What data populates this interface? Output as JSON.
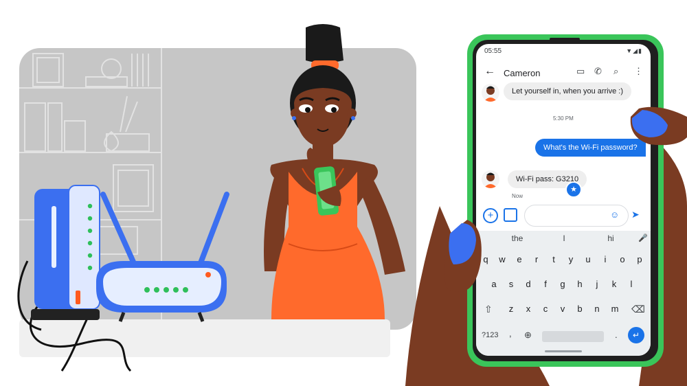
{
  "status_bar": {
    "time": "05:55",
    "icons": "▼◢▮"
  },
  "app_bar": {
    "back_icon": "←",
    "contact_name": "Cameron",
    "video_icon": "▭",
    "call_icon": "✆",
    "search_icon": "⌕",
    "more_icon": "⋮"
  },
  "messages": [
    {
      "direction": "incoming",
      "text": "Let yourself in, when you arrive :)"
    },
    {
      "direction": "timestamp",
      "text": "5:30 PM"
    },
    {
      "direction": "outgoing",
      "text": "What's the Wi-Fi password?"
    },
    {
      "direction": "incoming",
      "text": "Wi-Fi pass:  G3210",
      "starred": true,
      "meta": "Now"
    }
  ],
  "compose": {
    "plus_icon": "+",
    "emoji_icon": "☺",
    "send_icon": "➤"
  },
  "keyboard": {
    "suggestions": [
      "the",
      "I",
      "hi"
    ],
    "mic_icon": "🎤",
    "row1": [
      "q",
      "w",
      "e",
      "r",
      "t",
      "y",
      "u",
      "i",
      "o",
      "p"
    ],
    "row2": [
      "a",
      "s",
      "d",
      "f",
      "g",
      "h",
      "j",
      "k",
      "l"
    ],
    "row3": [
      "z",
      "x",
      "c",
      "v",
      "b",
      "n",
      "m"
    ],
    "shift_icon": "⇧",
    "backspace_icon": "⌫",
    "symbols_label": "?123",
    "comma_label": ",",
    "globe_icon": "⊕",
    "period_label": ".",
    "enter_icon": "↵"
  },
  "colors": {
    "phone_green": "#3ac55a",
    "accent_blue": "#1a73e8",
    "router_blue": "#3b6ff0",
    "skin": "#7a3b22",
    "dress": "#ff6a2c",
    "room_gray": "#c6c6c6"
  }
}
